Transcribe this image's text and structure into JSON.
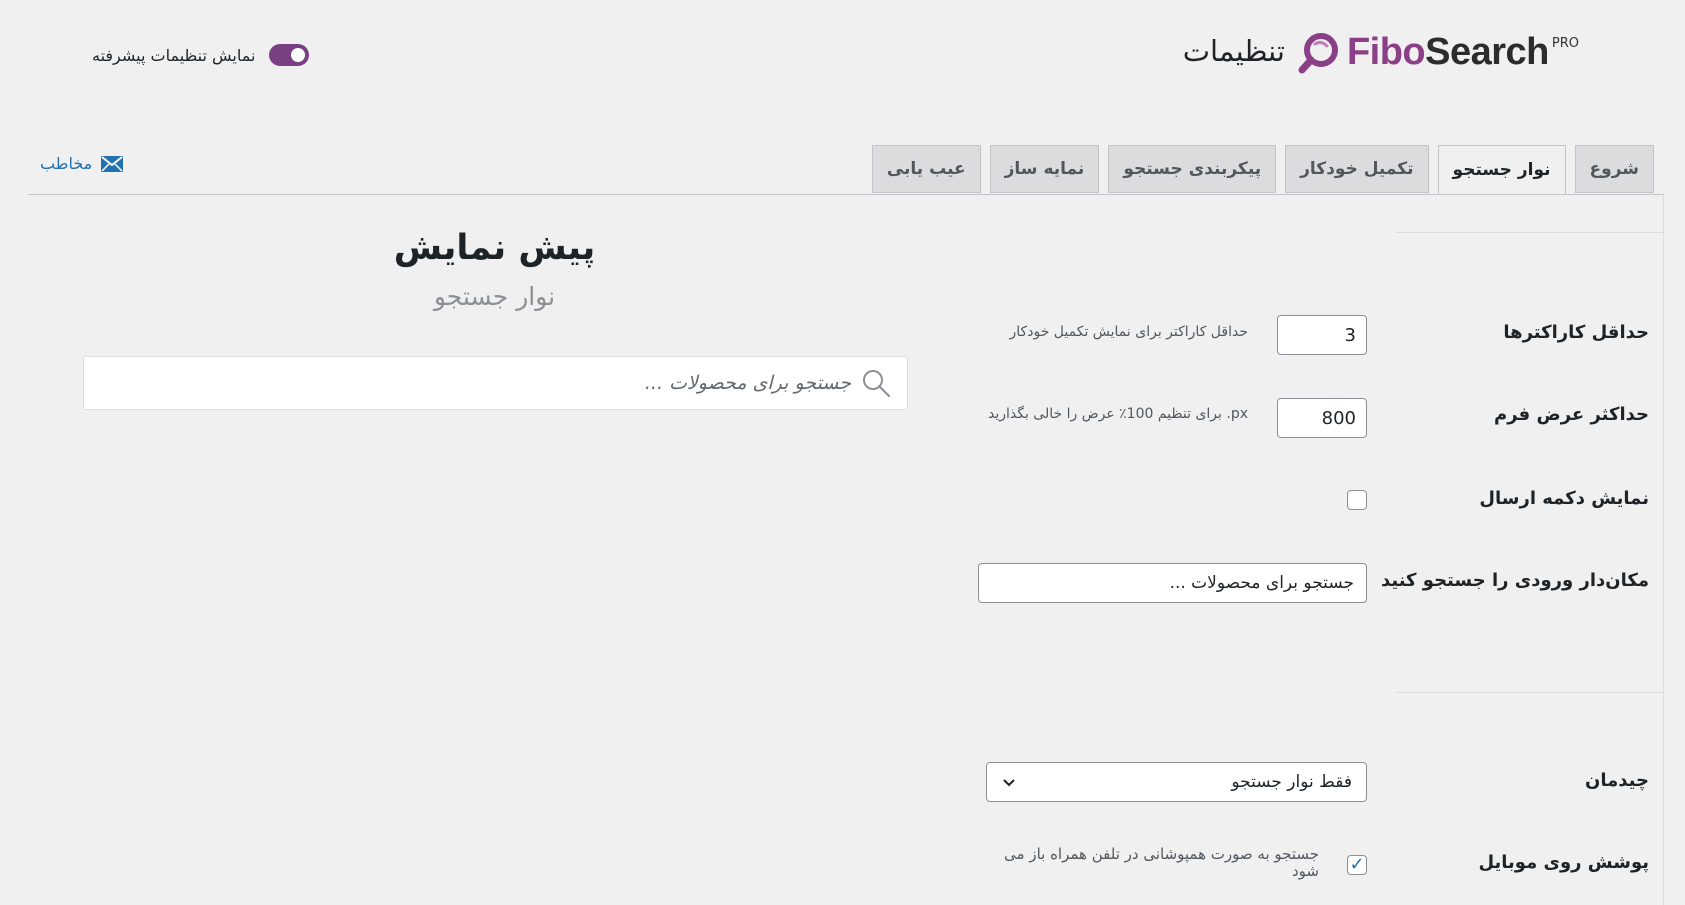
{
  "header": {
    "logo_fibo": "Fibo",
    "logo_search": "Search",
    "logo_pro": "PRO",
    "title": "تنظیمات",
    "advanced_toggle_label": "نمایش تنظیمات پیشرفته",
    "advanced_toggle_on": true,
    "contact_label": "مخاطب",
    "brand_color": "#7a3f83"
  },
  "tabs": [
    {
      "label": "شروع",
      "active": false
    },
    {
      "label": "نوار جستجو",
      "active": true
    },
    {
      "label": "تکمیل خودکار",
      "active": false
    },
    {
      "label": "پیکربندی جستجو",
      "active": false
    },
    {
      "label": "نمایه ساز",
      "active": false
    },
    {
      "label": "عیب یابی",
      "active": false
    }
  ],
  "settings": {
    "min_chars": {
      "label": "حداقل کاراکترها",
      "value": "3",
      "description": "حداقل کاراکتر برای نمایش تکمیل خودکار"
    },
    "max_width": {
      "label": "حداکثر عرض فرم",
      "value": "800",
      "description": "px. برای تنظیم 100٪ عرض را خالی بگذارید"
    },
    "submit_button": {
      "label": "نمایش دکمه ارسال",
      "checked": false
    },
    "placeholder": {
      "label": "مکان‌دار ورودی را جستجو کنید",
      "value": "جستجو برای محصولات ..."
    },
    "layout": {
      "label": "چیدمان",
      "selected": "فقط نوار جستجو"
    },
    "mobile_overlay": {
      "label": "پوشش روی موبایل",
      "checked": true,
      "description": "جستجو به صورت همپوشانی در تلفن همراه باز می شود"
    }
  },
  "preview": {
    "title": "پیش نمایش",
    "subtitle": "نوار جستجو",
    "search_placeholder": "جستجو برای محصولات ..."
  },
  "icons": {
    "logo": "fibosearch-logo-icon",
    "contact": "envelope-icon",
    "search": "magnifier-icon",
    "select": "chevron-down-icon",
    "check": "check-icon"
  }
}
